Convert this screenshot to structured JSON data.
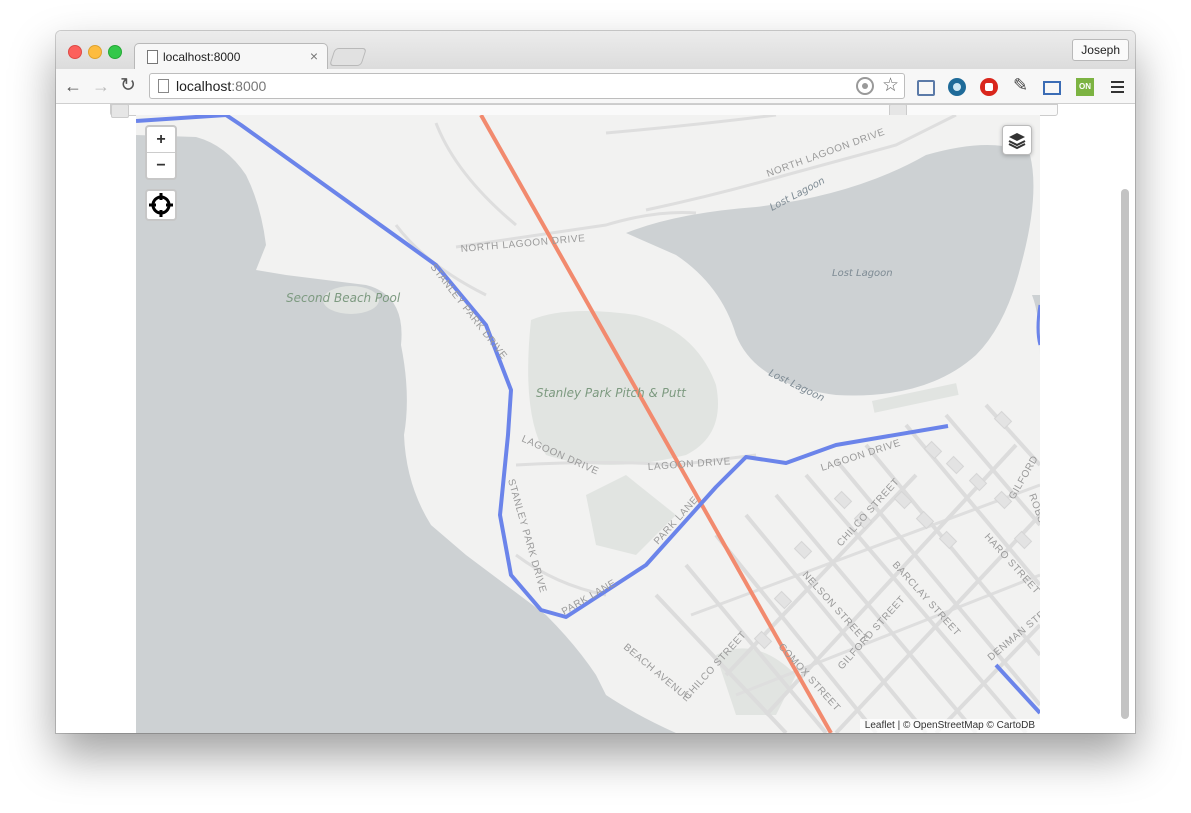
{
  "browser": {
    "tab_title": "localhost:8000",
    "tab_close": "×",
    "profile_name": "Joseph",
    "url_host": "localhost",
    "url_port": ":8000",
    "back": "←",
    "forward": "→",
    "reload": "↻",
    "star": "☆",
    "eyedropper": "✎",
    "ext_badge": "ON"
  },
  "map": {
    "zoom_in": "+",
    "zoom_out": "−",
    "attribution": "Leaflet | © OpenStreetMap © CartoDB",
    "street_labels": {
      "north_lagoon_top": "NORTH LAGOON DRIVE",
      "north_lagoon_mid": "NORTH LAGOON DRIVE",
      "stanley_park_north": "STANLEY PARK DRIVE",
      "stanley_park_south": "STANLEY PARK DRIVE",
      "lagoon_west": "LAGOON DRIVE",
      "lagoon_mid": "LAGOON DRIVE",
      "lagoon_east": "LAGOON DRIVE",
      "park_lane_south": "PARK LANE",
      "park_lane_north": "PARK LANE",
      "beach_avenue": "BEACH AVENUE",
      "chilco_south": "CHILCO STREET",
      "chilco_north": "CHILCO STREET",
      "comox": "COMOX STREET",
      "nelson": "NELSON STREET",
      "gilford_south": "GILFORD STREET",
      "gilford_north": "GILFORD",
      "barclay": "BARCLAY STREET",
      "haro": "HARO STREET",
      "robson": "ROBS",
      "denman": "DENMAN STR"
    },
    "place_labels": {
      "second_beach_pool": "Second Beach Pool",
      "pitch_and_putt": "Stanley Park Pitch & Putt",
      "lost_lagoon_center": "Lost Lagoon",
      "lost_lagoon_north": "Lost Lagoon",
      "lost_lagoon_south": "Lost Lagoon"
    },
    "colors": {
      "route_blue": "#6b84ea",
      "route_orange": "#f28a6e",
      "water": "#cdd1d3",
      "land": "#f2f2f1",
      "park": "#e1e4e1"
    }
  }
}
